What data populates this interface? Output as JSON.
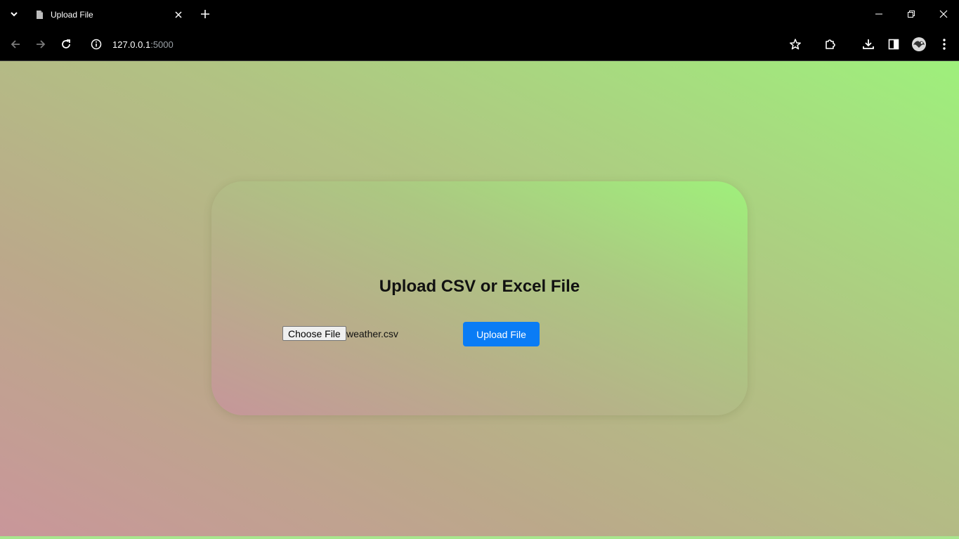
{
  "browser": {
    "tab": {
      "title": "Upload File"
    },
    "address": {
      "host": "127.0.0.1",
      "port": ":5000"
    }
  },
  "page": {
    "title": "Upload CSV or Excel File",
    "form": {
      "choose_file_label": "Choose File",
      "selected_file": "weather.csv",
      "upload_label": "Upload File"
    }
  },
  "colors": {
    "accent_button": "#0a7cf5",
    "gradient_start": "#c9969a",
    "gradient_end": "#9ef07c"
  }
}
